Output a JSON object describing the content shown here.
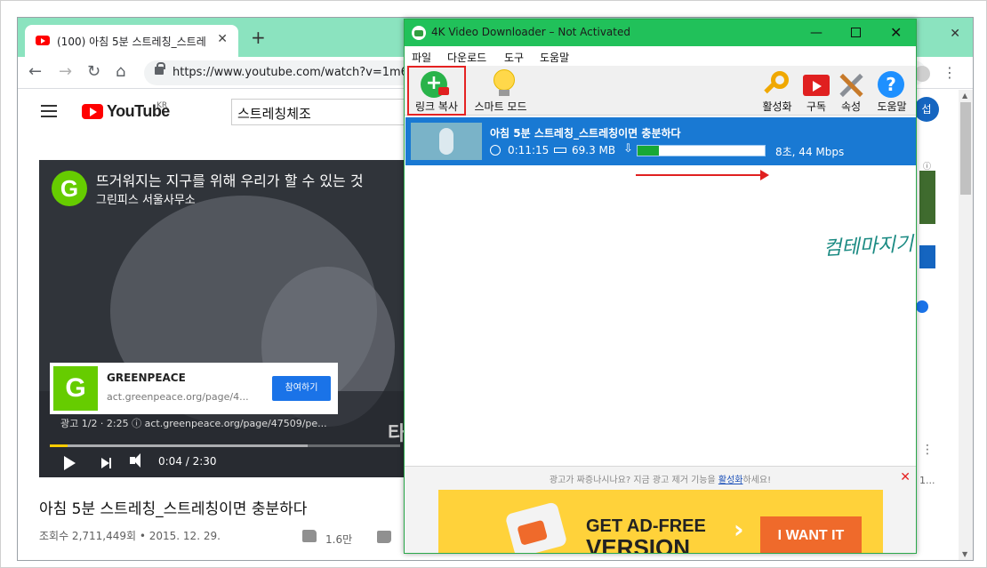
{
  "browser": {
    "tab_title": "(100) 아침 5분 스트레칭_스트레",
    "url": "https://www.youtube.com/watch?v=1m6"
  },
  "youtube": {
    "wordmark": "YouTube",
    "region": "KR",
    "search_value": "스트레칭체조",
    "user_initial": "섭",
    "player": {
      "overlay_title": "뜨거워지는 지구를 위해 우리가 할 수 있는 것",
      "overlay_sub": "그린피스 서울사무소",
      "ad_name": "GREENPEACE",
      "ad_url": "act.greenpeace.org/page/4...",
      "ad_cta": "참여하기",
      "ad_info": "광고 1/2 · 2:25  ⓘ  act.greenpeace.org/page/47509/pe...",
      "time": "0:04 / 2:30",
      "corner_text": "타",
      "progress": 0.05
    },
    "video_title": "아침 5분 스트레칭_스트레칭이면 충분하다",
    "views": "조회수 2,711,449회 • 2015. 12. 29.",
    "likes": "1.6만",
    "right_more": "1..."
  },
  "app": {
    "title": "4K Video Downloader – Not Activated",
    "menu": [
      "파일",
      "다운로드",
      "도구",
      "도움말"
    ],
    "tools": {
      "paste": "링크 복사",
      "smart": "스마트 모드",
      "activate": "활성화",
      "subscribe": "구독",
      "prefs": "속성",
      "help": "도움말"
    },
    "download": {
      "title": "아침 5분 스트레칭_스트레칭이면 충분하다",
      "duration": "0:11:15",
      "size": "69.3 MB",
      "progress": 0.17,
      "eta": "8초, 44 Mbps"
    },
    "ad_note_pre": "광고가 짜증나시나요? 지금 광고 제거 기능을 ",
    "ad_note_link": "활성화",
    "ad_note_post": "하세요!",
    "ad_line1": "GET AD-FREE",
    "ad_line2": "VERSION",
    "ad_cta": "I WANT IT"
  },
  "watermark": "컴테마지기"
}
